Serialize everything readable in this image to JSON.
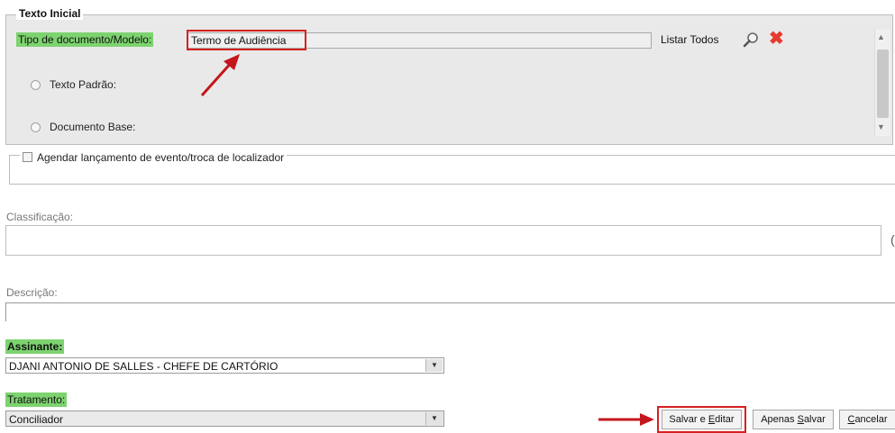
{
  "texto_inicial": {
    "legend": "Texto Inicial",
    "tipo_label": "Tipo de documento/Modelo:",
    "tipo_value": "Termo de Audiência",
    "listar_todos": "Listar Todos",
    "icons": [
      "magnifier-icon",
      "close-x-icon"
    ],
    "radio_texto_padrao": "Texto Padrão:",
    "radio_documento_base": "Documento Base:"
  },
  "agendar": {
    "label": "Agendar lançamento de evento/troca de localizador",
    "checked": false
  },
  "classificacao": {
    "label": "Classificação:",
    "value": ""
  },
  "descricao": {
    "label": "Descrição:",
    "value": ""
  },
  "assinante": {
    "label": "Assinante:",
    "selected": "DJANI ANTONIO DE SALLES - CHEFE DE CARTÓRIO"
  },
  "tratamento": {
    "label": "Tratamento:",
    "selected": "Conciliador"
  },
  "buttons": {
    "salvar_editar_prefix": "Salvar e ",
    "salvar_editar_u": "E",
    "salvar_editar_suffix": "ditar",
    "apenas_prefix": "Apenas ",
    "apenas_u": "S",
    "apenas_suffix": "alvar",
    "cancelar_u": "C",
    "cancelar_suffix": "ancelar"
  },
  "colors": {
    "highlight": "#7dd36f",
    "annotation_red": "#d62020",
    "x_red": "#e8392f"
  }
}
